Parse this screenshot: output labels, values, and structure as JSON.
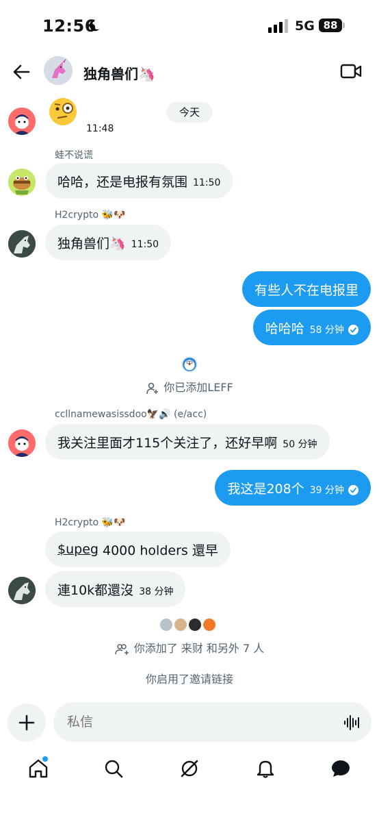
{
  "status_bar": {
    "time": "12:56",
    "network": "5G",
    "battery": "88"
  },
  "header": {
    "title": "独角兽们🦄"
  },
  "chat": {
    "date_label": "今天",
    "first_message": {
      "emoji": "🧐",
      "time": "11:48"
    },
    "msg2": {
      "sender": "蛙不说谎",
      "text": "哈哈，还是电报有氛围",
      "time": "11:50"
    },
    "msg3": {
      "sender": "H2crypto 🐝🐶",
      "text": "独角兽们🦄",
      "time": "11:50"
    },
    "out1": {
      "text": "有些人不在电报里"
    },
    "out2": {
      "text": "哈哈哈",
      "time": "58 分钟"
    },
    "system_added": "你已添加LEFF",
    "msg4": {
      "sender": "ccllnamewasissdoo🦅🔊 (e/acc)",
      "text": "我关注里面才115个关注了，还好早啊",
      "time": "50 分钟"
    },
    "out3": {
      "text": "我这是208个",
      "time": "39 分钟"
    },
    "msg5": {
      "sender": "H2crypto 🐝🐶",
      "link": "$upeg",
      "text_rest": " 4000 holders 還早"
    },
    "msg6": {
      "text": "連10k都還沒",
      "time": "38 分钟"
    },
    "system_added_many": "你添加了 来财 和另外 7 人",
    "system_invite": "你启用了邀请链接"
  },
  "composer": {
    "placeholder": "私信"
  },
  "colors": {
    "accent": "#1d9bf0",
    "bubble_in": "#eff3f4",
    "text_secondary": "#536471"
  },
  "tabs": [
    "home-icon",
    "search-icon",
    "grok-icon",
    "notifications-icon",
    "messages-icon"
  ]
}
